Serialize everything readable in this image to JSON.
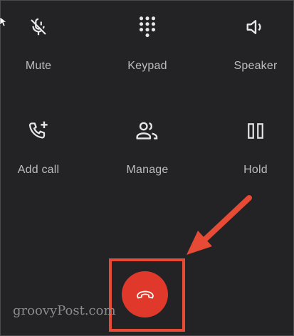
{
  "call_controls": {
    "mute": {
      "label": "Mute",
      "icon": "mic-off-icon"
    },
    "keypad": {
      "label": "Keypad",
      "icon": "dialpad-icon"
    },
    "speaker": {
      "label": "Speaker",
      "icon": "volume-icon"
    },
    "add_call": {
      "label": "Add call",
      "icon": "add-call-icon"
    },
    "manage": {
      "label": "Manage",
      "icon": "people-icon"
    },
    "hold": {
      "label": "Hold",
      "icon": "pause-icon"
    }
  },
  "end_call": {
    "icon": "hang-up-icon",
    "color": "#e0392c"
  },
  "annotation": {
    "color": "#e74a35"
  },
  "watermark": "groovyPost.com"
}
